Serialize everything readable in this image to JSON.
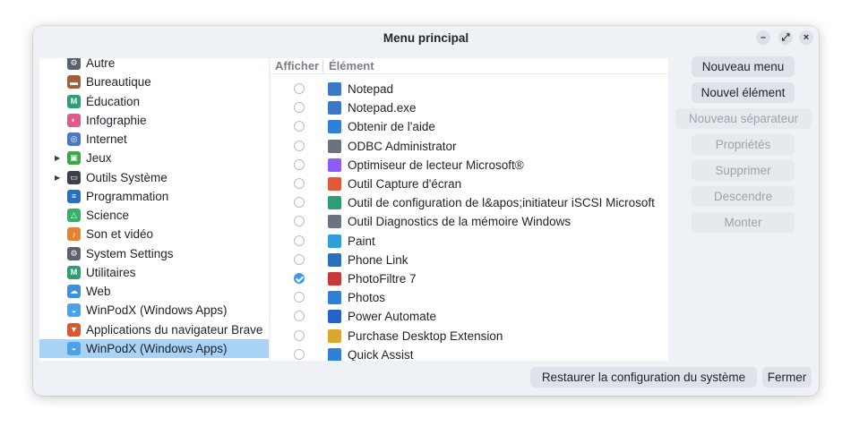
{
  "window": {
    "title": "Menu principal",
    "minimize_glyph": "–",
    "maximize_glyph": "⤢",
    "close_glyph": "×"
  },
  "tree": {
    "items": [
      {
        "label": "Autre",
        "icon": "gear-icon",
        "color": "#5a6170",
        "expander": false
      },
      {
        "label": "Bureautique",
        "icon": "briefcase-icon",
        "color": "#a0613a",
        "expander": false
      },
      {
        "label": "Éducation",
        "icon": "education-icon",
        "color": "#2f9e74",
        "expander": false
      },
      {
        "label": "Infographie",
        "icon": "graphics-icon",
        "color": "#e05a8a",
        "expander": false
      },
      {
        "label": "Internet",
        "icon": "globe-icon",
        "color": "#4a78c8",
        "expander": false
      },
      {
        "label": "Jeux",
        "icon": "gamepad-icon",
        "color": "#3aa845",
        "expander": true
      },
      {
        "label": "Outils Système",
        "icon": "monitor-icon",
        "color": "#3c4048",
        "expander": true
      },
      {
        "label": "Programmation",
        "icon": "code-icon",
        "color": "#2b6fbf",
        "expander": false
      },
      {
        "label": "Science",
        "icon": "flask-icon",
        "color": "#34b06a",
        "expander": false
      },
      {
        "label": "Son et vidéo",
        "icon": "media-icon",
        "color": "#e6822e",
        "expander": false
      },
      {
        "label": "System Settings",
        "icon": "settings-icon",
        "color": "#5a6170",
        "expander": false
      },
      {
        "label": "Utilitaires",
        "icon": "utilities-icon",
        "color": "#2f9e74",
        "expander": false
      },
      {
        "label": "Web",
        "icon": "cloud-icon",
        "color": "#3d8fe0",
        "expander": false
      },
      {
        "label": "WinPodX (Windows Apps)",
        "icon": "winpodx-icon",
        "color": "#4aa3e8",
        "expander": false
      },
      {
        "label": "Applications du navigateur Brave",
        "icon": "brave-icon",
        "color": "#e2542b",
        "expander": false
      },
      {
        "label": "WinPodX (Windows Apps)",
        "icon": "winpodx-icon",
        "color": "#4aa3e8",
        "expander": false,
        "selected": true
      }
    ]
  },
  "list": {
    "header_show": "Afficher",
    "header_item": "Élément",
    "rows": [
      {
        "label": "Notepad",
        "checked": false,
        "icon": "notepad-icon",
        "color": "#3c78c8"
      },
      {
        "label": "Notepad.exe",
        "checked": false,
        "icon": "notepad-icon",
        "color": "#3c78c8"
      },
      {
        "label": "Obtenir de l'aide",
        "checked": false,
        "icon": "help-icon",
        "color": "#2f80d9"
      },
      {
        "label": "ODBC Administrator",
        "checked": false,
        "icon": "database-icon",
        "color": "#6b7280"
      },
      {
        "label": "Optimiseur de lecteur Microsoft®",
        "checked": false,
        "icon": "drive-optimizer-icon",
        "color": "#8b5cf6"
      },
      {
        "label": "Outil Capture d'écran",
        "checked": false,
        "icon": "snipping-icon",
        "color": "#e05a3a"
      },
      {
        "label": "Outil de configuration de l&apos;initiateur iSCSI Microsoft",
        "checked": false,
        "icon": "globe-network-icon",
        "color": "#2f9e74"
      },
      {
        "label": "Outil Diagnostics de la mémoire Windows",
        "checked": false,
        "icon": "memory-icon",
        "color": "#6b7280"
      },
      {
        "label": "Paint",
        "checked": false,
        "icon": "paint-icon",
        "color": "#2f9ed9"
      },
      {
        "label": "Phone Link",
        "checked": false,
        "icon": "phone-icon",
        "color": "#2b6fbf"
      },
      {
        "label": "PhotoFiltre 7",
        "checked": true,
        "icon": "photofiltre-icon",
        "color": "#c83a3a"
      },
      {
        "label": "Photos",
        "checked": false,
        "icon": "photos-icon",
        "color": "#2f80d9"
      },
      {
        "label": "Power Automate",
        "checked": false,
        "icon": "power-automate-icon",
        "color": "#2563c9"
      },
      {
        "label": "Purchase Desktop Extension",
        "checked": false,
        "icon": "package-icon",
        "color": "#d9a62f"
      },
      {
        "label": "Quick Assist",
        "checked": false,
        "icon": "quick-assist-icon",
        "color": "#2f80d9"
      }
    ]
  },
  "buttons": {
    "new_menu": "Nouveau menu",
    "new_item": "Nouvel élément",
    "new_separator": "Nouveau séparateur",
    "properties": "Propriétés",
    "delete": "Supprimer",
    "move_down": "Descendre",
    "move_up": "Monter",
    "restore": "Restaurer la configuration du système",
    "close": "Fermer"
  },
  "colors": {
    "selection": "#a8d3f5",
    "accent": "#3d9be9"
  }
}
